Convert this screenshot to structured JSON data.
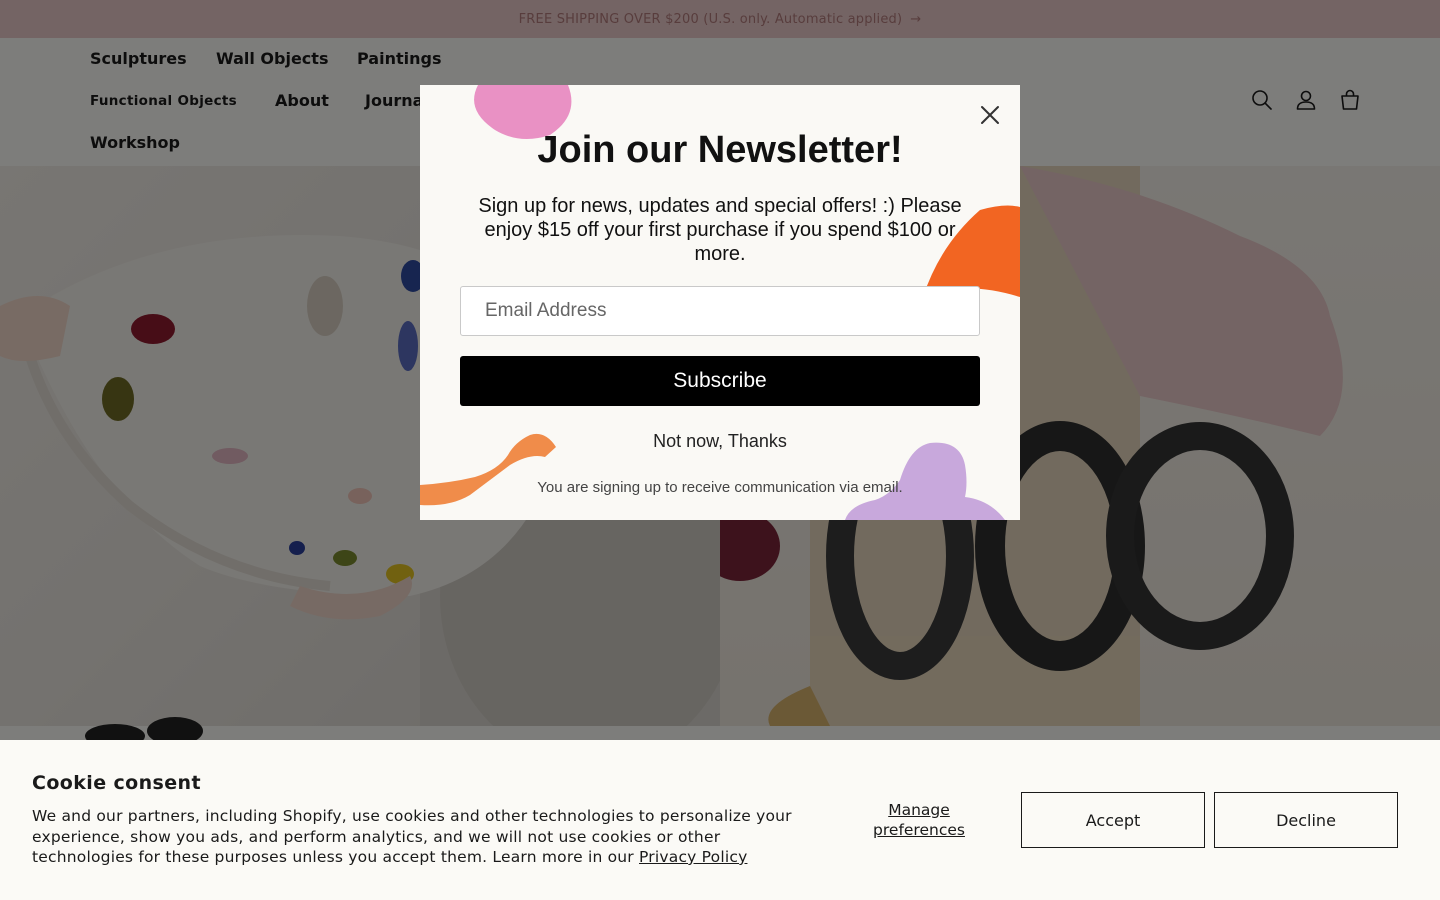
{
  "announcement": {
    "text": "FREE SHIPPING OVER $200 (U.S. only. Automatic applied)",
    "arrow": "→"
  },
  "nav": {
    "items": [
      {
        "label": "Sculptures"
      },
      {
        "label": "Wall Objects"
      },
      {
        "label": "Paintings"
      },
      {
        "label": "Functional Objects"
      },
      {
        "label": "About"
      },
      {
        "label": "Journal"
      },
      {
        "label": "Workshop"
      }
    ],
    "icons": [
      "search-icon",
      "account-icon",
      "cart-icon"
    ]
  },
  "newsletter": {
    "title": "Join our Newsletter!",
    "description": "Sign up for news, updates and special offers! :) Please enjoy $15 off your first purchase if you spend $100 or more.",
    "email_placeholder": "Email Address",
    "subscribe_label": "Subscribe",
    "decline_label": "Not now, Thanks",
    "legal": "You are signing up to receive communication via email.",
    "close_icon": "close-icon"
  },
  "cookie": {
    "title": "Cookie consent",
    "text": "We and our partners, including Shopify, use cookies and other technologies to personalize your experience, show you ads, and perform analytics, and we will not use cookies or other technologies for these purposes unless you accept them. Learn more in our ",
    "link": "Privacy Policy",
    "manage_label": "Manage preferences",
    "accept_label": "Accept",
    "decline_label": "Decline"
  },
  "colors": {
    "announcement_bg": "#e8c8c8",
    "page_bg": "#fbfaf6",
    "modal_bg": "#faf9f5",
    "subscribe_bg": "#000000",
    "blob_pink": "#e991c4",
    "blob_orange": "#f26522",
    "blob_light_orange": "#f08c4a",
    "blob_lilac": "#c8a8dc"
  }
}
